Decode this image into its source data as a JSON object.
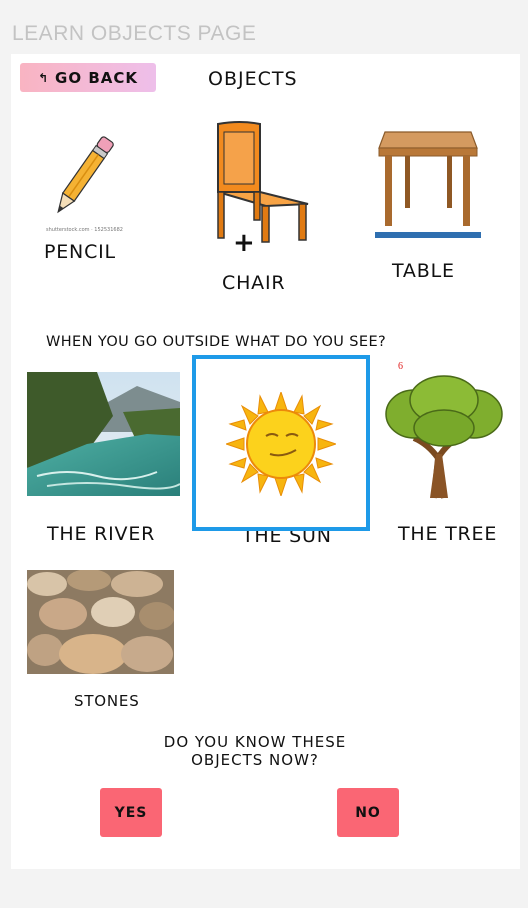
{
  "header": {
    "title": "LEARN OBJECTS PAGE"
  },
  "nav": {
    "go_back_arrow": "↰",
    "go_back_label": "GO BACK"
  },
  "objects_section": {
    "title": "OBJECTS",
    "items": [
      {
        "label": "PENCIL",
        "icon": "pencil-image",
        "caption": "shutterstock.com · 152531682"
      },
      {
        "label": "CHAIR",
        "icon": "chair-image"
      },
      {
        "label": "TABLE",
        "icon": "table-image"
      }
    ]
  },
  "outside_section": {
    "question": "WHEN YOU GO OUTSIDE WHAT DO YOU SEE?",
    "badge": "6",
    "items": [
      {
        "label": "THE RIVER",
        "icon": "river-photo"
      },
      {
        "label": "THE SUN",
        "icon": "sun-image",
        "selected": true
      },
      {
        "label": "THE TREE",
        "icon": "tree-image"
      },
      {
        "label": "STONES",
        "icon": "stones-photo"
      }
    ]
  },
  "quiz": {
    "question_line1": "DO YOU KNOW THESE",
    "question_line2": "OBJECTS NOW?",
    "yes_label": "YES",
    "no_label": "NO"
  },
  "colors": {
    "selection": "#1e9ae8",
    "answer_button": "#fa6674",
    "go_back_gradient_start": "#f9b4c2",
    "go_back_gradient_end": "#eebfea"
  }
}
